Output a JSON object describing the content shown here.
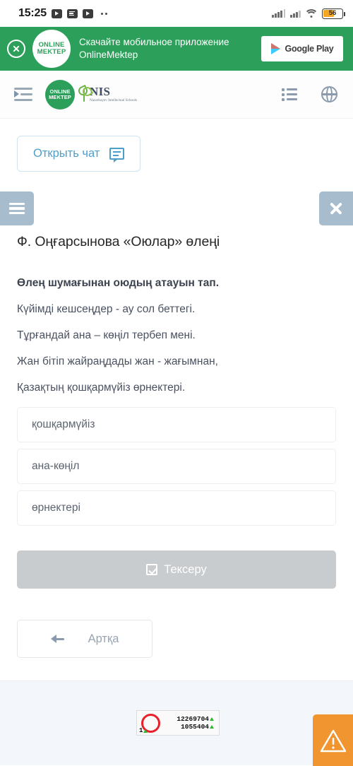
{
  "status_bar": {
    "time": "15:25",
    "icons": [
      "play-video-icon",
      "document-icon",
      "play-video-icon",
      "more-dots-icon"
    ],
    "signal": "signal-bars-icon",
    "wifi": "wifi-icon",
    "battery_level": "56"
  },
  "promo_banner": {
    "close_icon": "close-circle-icon",
    "logo_line1": "ONLINE",
    "logo_line2": "MEKTEP",
    "text": "Скачайте мобильное приложение OnlineMektep",
    "store_button": "Google Play",
    "background_color": "#2ca05a"
  },
  "app_header": {
    "menu_icon": "indent-menu-icon",
    "om_logo_line1": "ONLINE",
    "om_logo_line2": "MEKTEP",
    "nis_name": "NIS",
    "nis_subtitle": "Nazarbayev Intellectual Schools",
    "list_icon": "list-icon",
    "language_icon": "globe-icon"
  },
  "chat": {
    "label": "Открыть чат",
    "icon": "chat-bubble-icon",
    "color": "#4d9ecb"
  },
  "quiz": {
    "menu_icon": "hamburger-icon",
    "close_icon": "close-x-icon",
    "title": "Ф. Оңғарсынова «Оюлар» өлеңі",
    "prompt": "Өлең шумағынан оюдың атауын тап.",
    "poem_lines": [
      "Күйімді кешсеңдер - ау сол беттегі.",
      "Тұрғандай ана – көңіл тербеп мені.",
      "Жан бітіп жайраңдады жан - жағымнан,",
      "Қазақтың қошқармүйіз өрнектері."
    ],
    "options": [
      "қошқармүйіз",
      "ана-көңіл",
      "өрнектері"
    ],
    "check_button": {
      "label": "Тексеру",
      "icon": "checkbox-checked-icon",
      "disabled_color": "#c9cccf"
    },
    "back_button": {
      "label": "Артқа",
      "icon": "arrow-left-icon"
    }
  },
  "footer": {
    "counter": {
      "ring_icon": "red-circle-icon",
      "value_1": "12269704",
      "value_2": "1055404",
      "value_3": "1",
      "trend_icon": "up-triangle-icon"
    },
    "warning_button": {
      "icon": "warning-triangle-icon",
      "color": "#f0952f"
    }
  }
}
